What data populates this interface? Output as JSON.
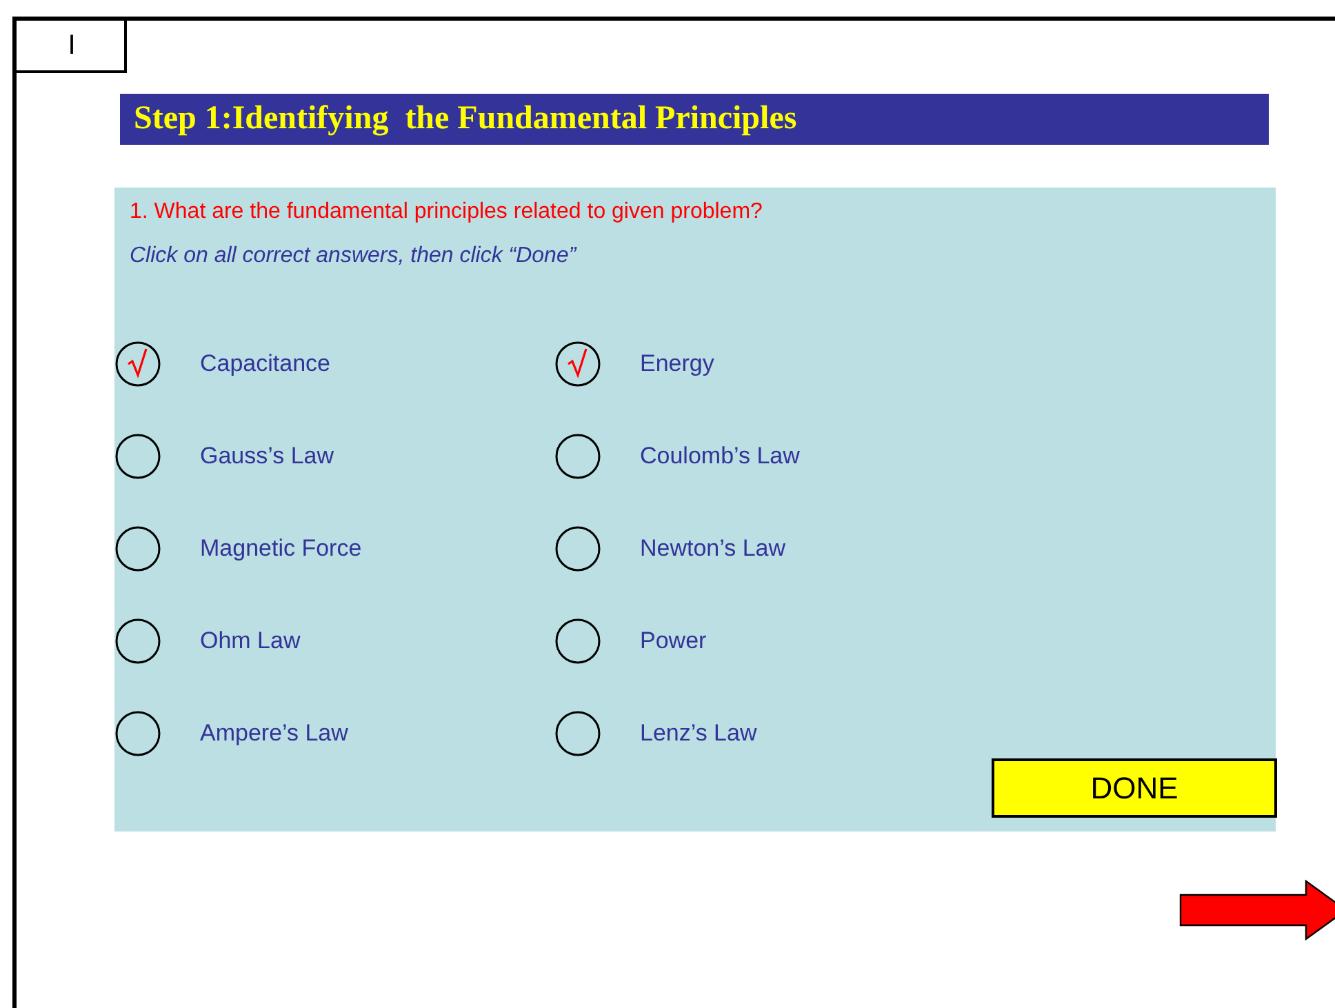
{
  "tab": {
    "label": "I"
  },
  "title": "Step 1:Identifying  the Fundamental Principles",
  "question": "1. What are the fundamental principles related to given problem?",
  "instruction": "Click on all correct answers, then click “Done”",
  "options": [
    {
      "label": "Capacitance",
      "checked": true
    },
    {
      "label": "Energy",
      "checked": true
    },
    {
      "label": "Gauss’s Law",
      "checked": false
    },
    {
      "label": "Coulomb’s Law",
      "checked": false
    },
    {
      "label": "Magnetic Force",
      "checked": false
    },
    {
      "label": "Newton’s Law",
      "checked": false
    },
    {
      "label": "Ohm Law",
      "checked": false
    },
    {
      "label": "Power",
      "checked": false
    },
    {
      "label": "Ampere’s Law",
      "checked": false
    },
    {
      "label": "Lenz’s Law",
      "checked": false
    }
  ],
  "done_button": "DONE"
}
